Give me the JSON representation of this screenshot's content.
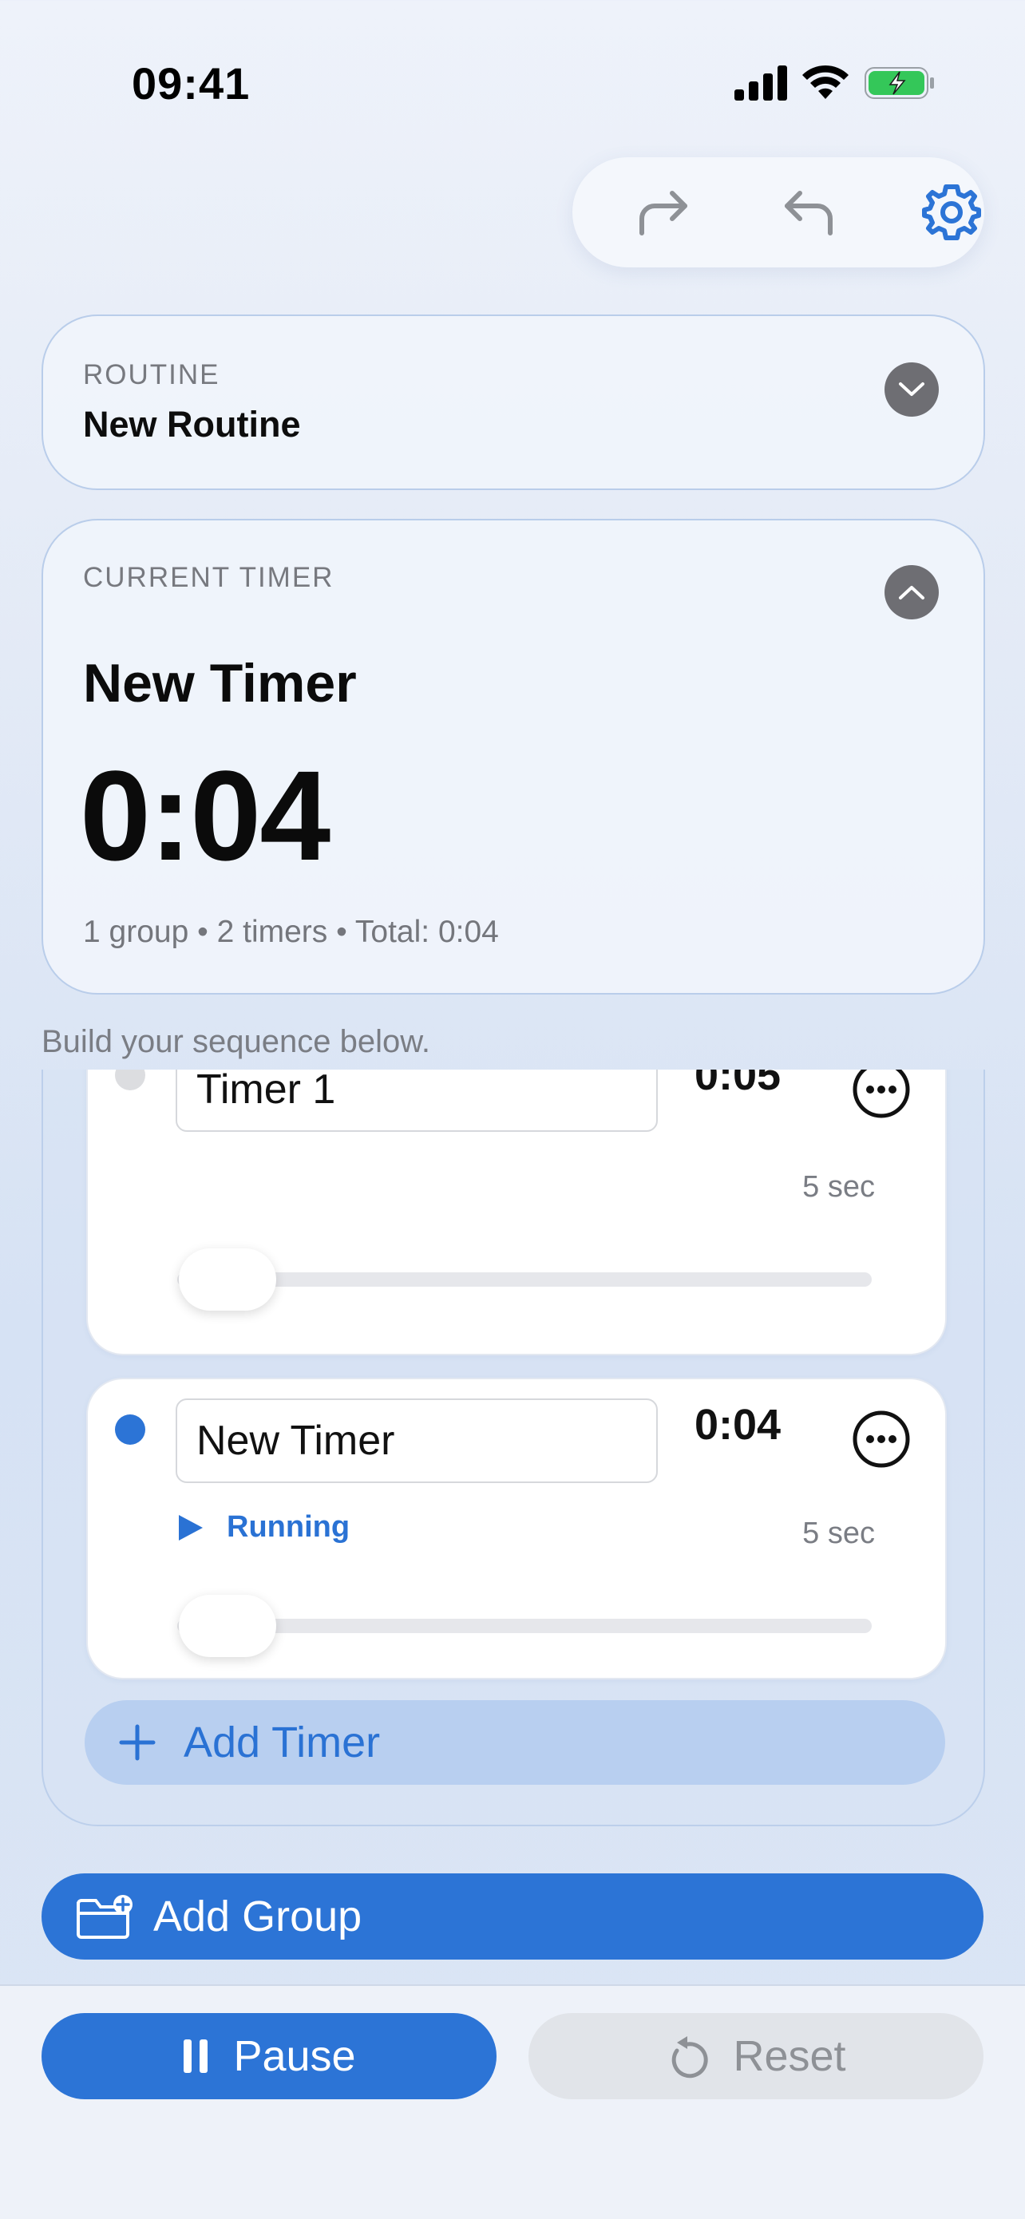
{
  "status_bar": {
    "time": "09:41"
  },
  "toolbar": {
    "redo_icon": "redo-arrow-icon",
    "undo_icon": "undo-arrow-icon",
    "settings_icon": "gear-icon"
  },
  "routine": {
    "label": "ROUTINE",
    "name": "New Routine"
  },
  "current_timer": {
    "label": "CURRENT TIMER",
    "name": "New Timer",
    "remaining": "0:04",
    "summary": "1 group • 2 timers • Total: 0:04"
  },
  "hint": "Build your sequence below.",
  "timers": [
    {
      "name": "Timer 1",
      "duration": "0:05",
      "seconds": "5 sec",
      "progress": 0,
      "active": false
    },
    {
      "name": "New Timer",
      "duration": "0:04",
      "seconds": "5 sec",
      "status": "Running",
      "progress": 0,
      "active": true
    }
  ],
  "buttons": {
    "add_timer": "Add Timer",
    "add_group": "Add Group",
    "pause": "Pause",
    "reset": "Reset"
  },
  "colors": {
    "accent": "#2c74d6",
    "inactive_dot": "#dcdde0",
    "running": "#2a72d4"
  }
}
